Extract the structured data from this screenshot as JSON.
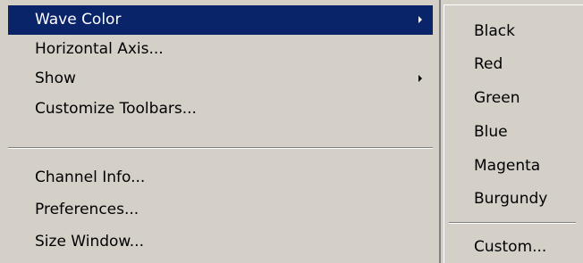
{
  "menu": {
    "items": [
      {
        "label": "Wave Color",
        "submenu": true,
        "highlighted": true
      },
      {
        "label": "Horizontal Axis...",
        "submenu": false
      },
      {
        "label": "Show",
        "submenu": true
      },
      {
        "label": "Customize Toolbars...",
        "submenu": false
      },
      {
        "label": "Channel Info...",
        "submenu": false
      },
      {
        "label": "Preferences...",
        "submenu": false
      },
      {
        "label": "Size Window...",
        "submenu": false
      }
    ]
  },
  "submenu": {
    "items": [
      {
        "label": "Black"
      },
      {
        "label": "Red"
      },
      {
        "label": "Green"
      },
      {
        "label": "Blue"
      },
      {
        "label": "Magenta"
      },
      {
        "label": "Burgundy"
      },
      {
        "label": "Custom..."
      }
    ]
  },
  "colors": {
    "menu_background": "#d4d0c8",
    "highlight_background": "#0a246a",
    "highlight_text": "#ffffff"
  }
}
